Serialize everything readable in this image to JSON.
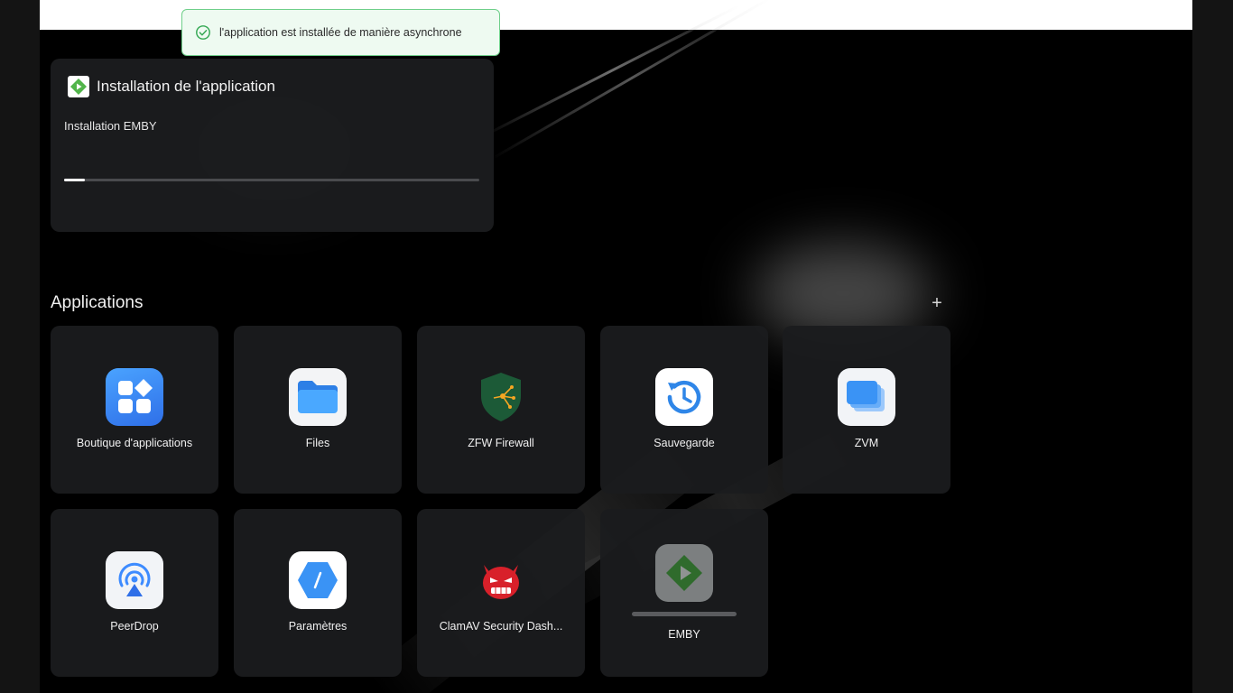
{
  "toast": {
    "message": "l'application est installée de manière asynchrone"
  },
  "install": {
    "title": "Installation de l'application",
    "subtitle": "Installation EMBY",
    "progress": 0.05
  },
  "applications": {
    "title": "Applications",
    "add_label": "+",
    "items": [
      {
        "label": "Boutique d'applications",
        "icon": "app-store-icon"
      },
      {
        "label": "Files",
        "icon": "folder-icon"
      },
      {
        "label": "ZFW Firewall",
        "icon": "firewall-shield-icon"
      },
      {
        "label": "Sauvegarde",
        "icon": "backup-clock-icon"
      },
      {
        "label": "ZVM",
        "icon": "vm-windows-icon"
      },
      {
        "label": "PeerDrop",
        "icon": "peerdrop-icon"
      },
      {
        "label": "Paramètres",
        "icon": "settings-hexagon-icon"
      },
      {
        "label": "ClamAV Security Dash...",
        "icon": "clamav-devil-icon"
      },
      {
        "label": "EMBY",
        "icon": "emby-icon",
        "installing": true
      }
    ]
  },
  "colors": {
    "toast_border": "#6fcf8a",
    "emby_green": "#52b54b",
    "accent_blue": "#3d8bff"
  }
}
